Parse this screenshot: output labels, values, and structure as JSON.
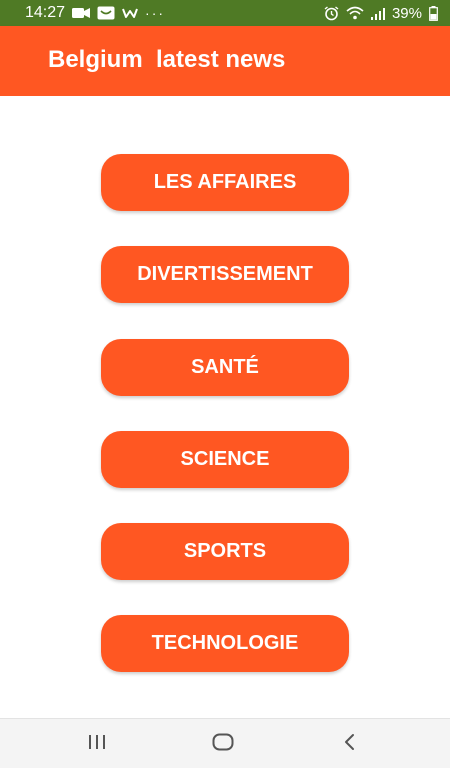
{
  "status_bar": {
    "time": "14:27",
    "overflow": "···",
    "battery": "39%",
    "icons": [
      "video-icon",
      "message-icon",
      "app-w-icon",
      "alarm-icon",
      "wifi-icon",
      "signal-icon",
      "battery-icon"
    ]
  },
  "app_bar": {
    "title": "Belgium  latest news"
  },
  "categories": [
    {
      "label": "LES AFFAIRES"
    },
    {
      "label": "DIVERTISSEMENT"
    },
    {
      "label": "SANTÉ"
    },
    {
      "label": "SCIENCE"
    },
    {
      "label": "SPORTS"
    },
    {
      "label": "TECHNOLOGIE"
    }
  ],
  "nav_bar": {
    "icons": [
      "recents-icon",
      "home-icon",
      "back-icon"
    ]
  },
  "colors": {
    "accent": "#ff5722",
    "status_bar": "#4f7a25",
    "background": "#ffffff",
    "nav_bar": "#f4f4f4"
  }
}
